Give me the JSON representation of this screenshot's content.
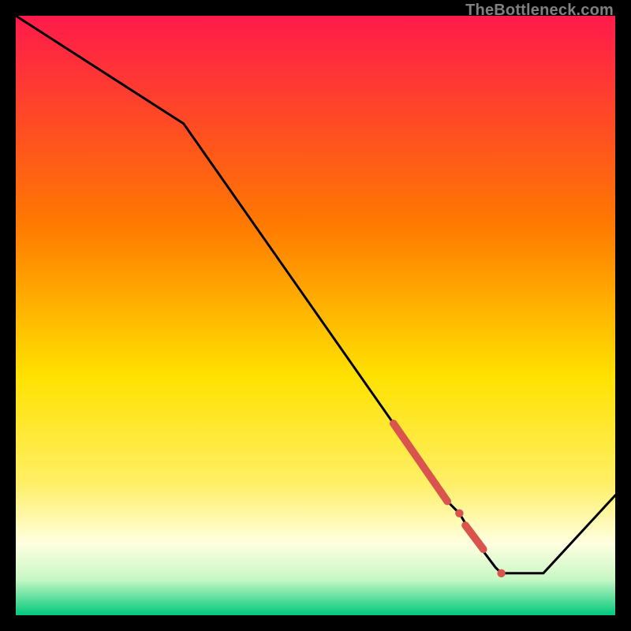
{
  "watermark": "TheBottleneck.com",
  "colors": {
    "frame": "#000000",
    "line": "#000000",
    "marker": "#d9544d",
    "gradient_top": "#ff1a4b",
    "gradient_mid1": "#ffa500",
    "gradient_mid2": "#ffe100",
    "gradient_pale": "#ffffe0",
    "gradient_bottom": "#00c97b"
  },
  "chart_data": {
    "type": "line",
    "title": "",
    "xlabel": "",
    "ylabel": "",
    "xlim": [
      0,
      100
    ],
    "ylim": [
      0,
      100
    ],
    "background": "red-yellow-green vertical gradient",
    "x": [
      0,
      28,
      63,
      68,
      70,
      72,
      74,
      77,
      80,
      81,
      88,
      100
    ],
    "y": [
      100,
      82,
      32,
      25,
      22,
      19,
      17,
      12,
      8,
      7,
      7,
      20
    ],
    "markers": [
      {
        "kind": "segment",
        "x0": 63,
        "y0": 32,
        "x1": 72,
        "y1": 19,
        "thick": 6
      },
      {
        "kind": "dot",
        "x": 74,
        "y": 17,
        "r": 4
      },
      {
        "kind": "segment",
        "x0": 75,
        "y0": 15,
        "x1": 78,
        "y1": 11,
        "thick": 6
      },
      {
        "kind": "dot",
        "x": 81,
        "y": 7,
        "r": 4
      }
    ]
  }
}
